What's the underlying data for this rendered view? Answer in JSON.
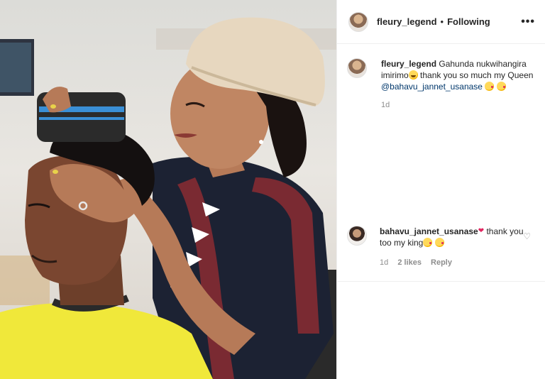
{
  "header": {
    "username": "fleury_legend",
    "separator": "•",
    "follow_state": "Following",
    "more_icon": "more-horizontal-icon"
  },
  "caption": {
    "username": "fleury_legend",
    "text_1": "Gahunda nukwihangira imirimo",
    "text_2": " thank you so much my Queen ",
    "mention": "@bahavu_jannet_usanase",
    "time": "1d"
  },
  "comments": [
    {
      "username": "bahavu_jannet_usanase",
      "text": "thank you too my king",
      "time": "1d",
      "likes": "2 likes",
      "reply_label": "Reply",
      "like_icon": "heart-outline-icon"
    }
  ],
  "colors": {
    "accent_mention": "#00376b",
    "text": "#262626",
    "muted": "#8e8e8e",
    "cape": "#f0e83a",
    "apron": "#7a2a32"
  }
}
